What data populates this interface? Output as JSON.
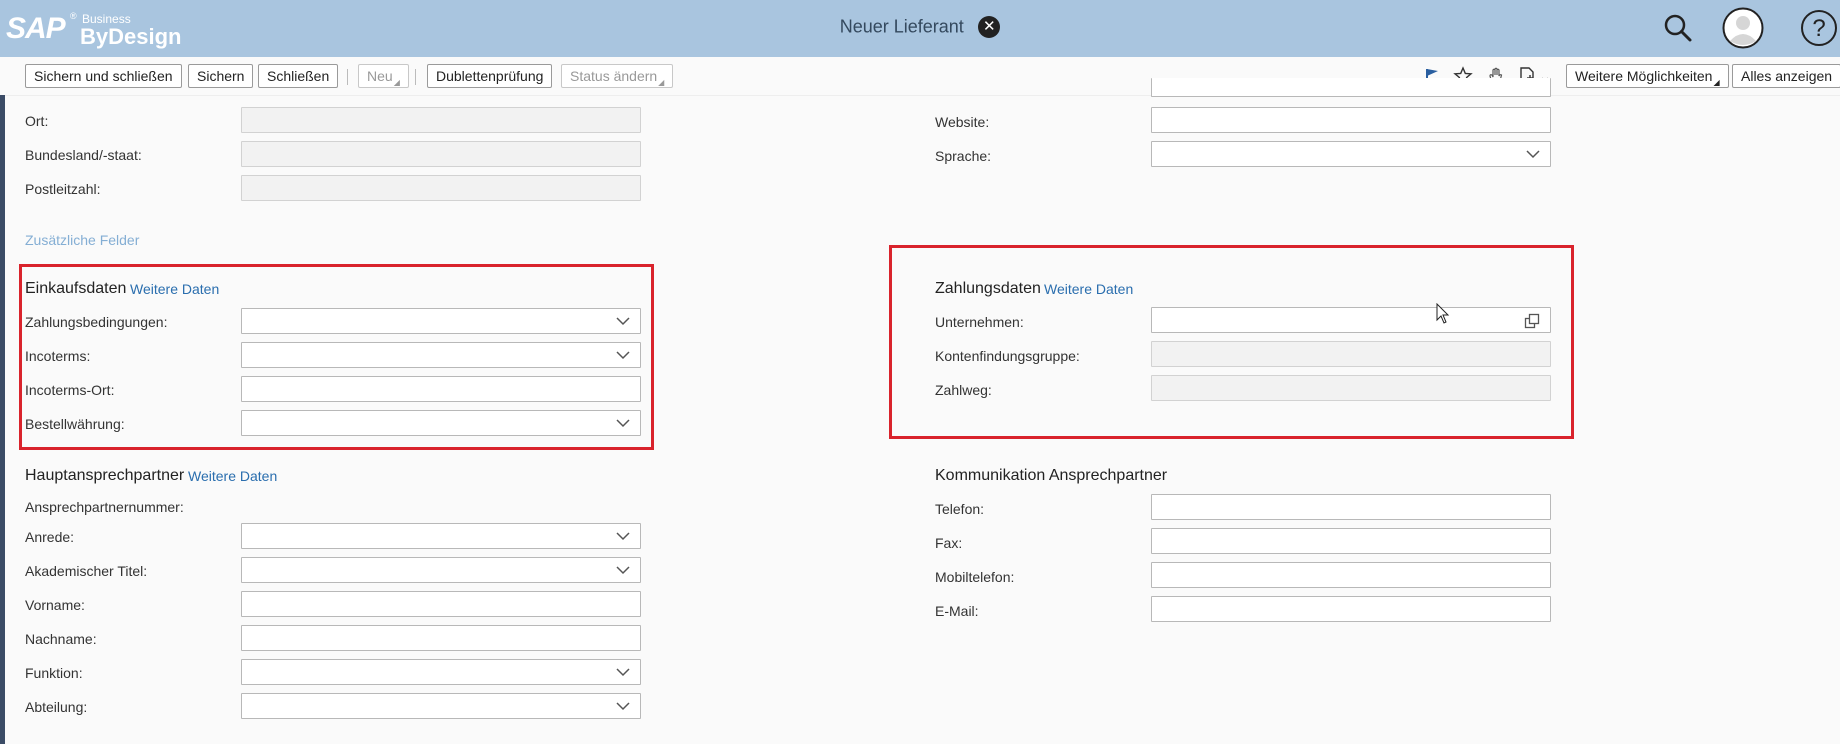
{
  "brand": {
    "sap": "SAP",
    "reg": "®",
    "business": "Business",
    "bydesign": "ByDesign"
  },
  "window": {
    "title": "Neuer Lieferant"
  },
  "toolbar": {
    "save_close": "Sichern und schließen",
    "save": "Sichern",
    "close": "Schließen",
    "new": "Neu",
    "duplicate_check": "Dublettenprüfung",
    "change_status": "Status ändern",
    "more_options": "Weitere Möglichkeiten",
    "show_all": "Alles anzeigen"
  },
  "address": {
    "city": {
      "label": "Ort:",
      "value": ""
    },
    "state": {
      "label": "Bundesland/-staat:",
      "value": ""
    },
    "postal": {
      "label": "Postleitzahl:",
      "value": ""
    },
    "additional_fields": "Zusätzliche Felder"
  },
  "web": {
    "website": {
      "label": "Website:",
      "value": ""
    },
    "language": {
      "label": "Sprache:",
      "value": ""
    }
  },
  "purchasing": {
    "title": "Einkaufsdaten",
    "more": "Weitere Daten",
    "payment_terms": {
      "label": "Zahlungsbedingungen:",
      "value": ""
    },
    "incoterms": {
      "label": "Incoterms:",
      "value": ""
    },
    "incoterms_location": {
      "label": "Incoterms-Ort:",
      "value": ""
    },
    "order_currency": {
      "label": "Bestellwährung:",
      "value": ""
    }
  },
  "payment": {
    "title": "Zahlungsdaten",
    "more": "Weitere Daten",
    "company": {
      "label": "Unternehmen:",
      "value": ""
    },
    "account_group": {
      "label": "Kontenfindungsgruppe:",
      "value": ""
    },
    "payment_method": {
      "label": "Zahlweg:",
      "value": ""
    }
  },
  "contact": {
    "title": "Hauptansprechpartner",
    "more": "Weitere Daten",
    "number": {
      "label": "Ansprechpartnernummer:",
      "value": ""
    },
    "salutation": {
      "label": "Anrede:",
      "value": ""
    },
    "academic_title": {
      "label": "Akademischer Titel:",
      "value": ""
    },
    "first_name": {
      "label": "Vorname:",
      "value": ""
    },
    "last_name": {
      "label": "Nachname:",
      "value": ""
    },
    "function": {
      "label": "Funktion:",
      "value": ""
    },
    "department": {
      "label": "Abteilung:",
      "value": ""
    }
  },
  "communication": {
    "title": "Kommunikation Ansprechpartner",
    "phone": {
      "label": "Telefon:",
      "value": ""
    },
    "fax": {
      "label": "Fax:",
      "value": ""
    },
    "mobile": {
      "label": "Mobiltelefon:",
      "value": ""
    },
    "email": {
      "label": "E-Mail:",
      "value": ""
    }
  },
  "colors": {
    "shell": "#a9c5df",
    "link": "#2a6eae",
    "highlight": "#d9232c"
  },
  "icons": [
    "search-icon",
    "user-avatar-icon",
    "help-icon",
    "flag-icon",
    "star-icon",
    "hand-icon",
    "new-document-icon",
    "chevron-down-icon",
    "value-help-icon",
    "close-icon"
  ]
}
